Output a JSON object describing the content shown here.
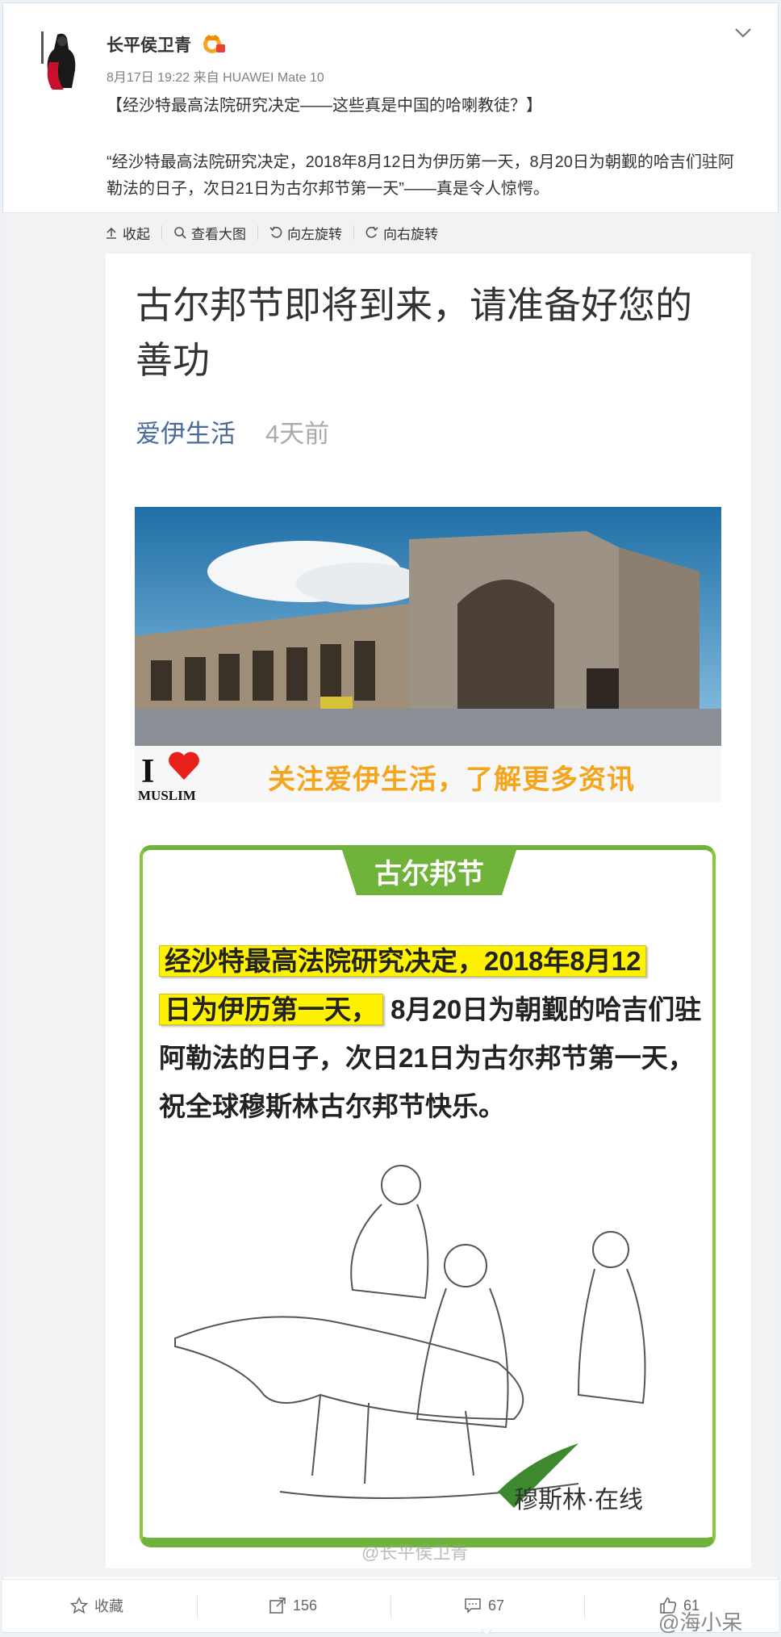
{
  "post": {
    "username": "长平侯卫青",
    "meta": "8月17日 19:22 来自 HUAWEI Mate 10",
    "title": "【经沙特最高法院研究决定——这些真是中国的哈喇教徒？】",
    "body": "“经沙特最高法院研究决定，2018年8月12日为伊历第一天，8月20日为朝觐的哈吉们驻阿勒法的日子，次日21日为古尔邦节第一天”——真是令人惊愕。"
  },
  "toolbar": {
    "collapse": "收起",
    "view_large": "查看大图",
    "rotate_left": "向左旋转",
    "rotate_right": "向右旋转"
  },
  "article": {
    "title": "古尔邦节即将到来，请准备好您的善功",
    "source": "爱伊生活",
    "time": "4天前",
    "banner": {
      "i_love": "I",
      "muslim": "MUSLIM",
      "follow": "关注爱伊生活，了解更多资讯"
    },
    "poster": {
      "tab": "古尔邦节",
      "highlight_1": "经沙特最高法院研究决定，2018年8月12",
      "highlight_2": "日为伊历第一天，",
      "rest": "8月20日为朝觐的哈吉们驻阿勒法的日子，次日21日为古尔邦节第一天，祝全球穆斯林古尔邦节快乐。",
      "signature": "穆斯林·在线"
    }
  },
  "watermark": "@长平侯卫青",
  "footer": {
    "favorite": "收藏",
    "repost_count": "156",
    "comment_count": "67",
    "like_count": "61"
  },
  "corner_watermark": "@海小呆",
  "colors": {
    "poster_green": "#6fb33a",
    "highlight": "#fff200",
    "source_blue": "#4a6a9a",
    "follow_orange": "#f4a51c"
  }
}
